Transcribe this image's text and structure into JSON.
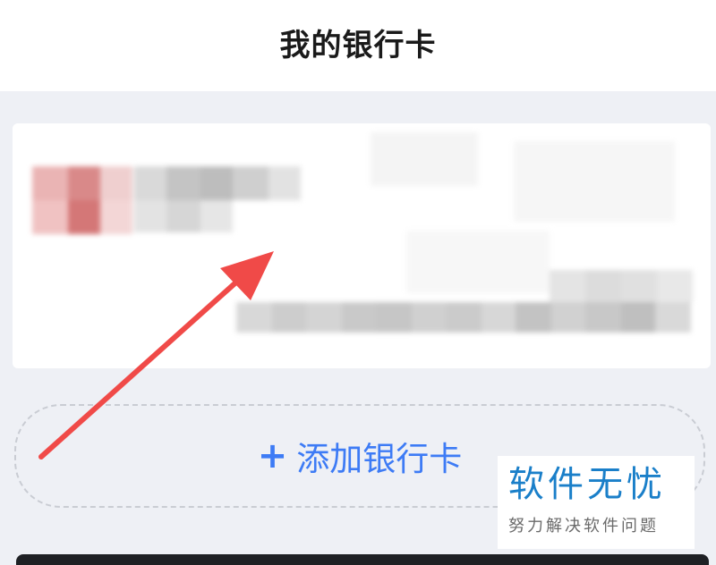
{
  "header": {
    "title": "我的银行卡"
  },
  "add_card": {
    "plus": "+",
    "label": "添加银行卡"
  },
  "watermark": {
    "title": "软件无忧",
    "subtitle": "努力解决软件问题"
  },
  "colors": {
    "accent": "#3d7bf5",
    "arrow": "#f04a48",
    "watermark": "#1a7fc9",
    "background": "#eef0f5"
  }
}
